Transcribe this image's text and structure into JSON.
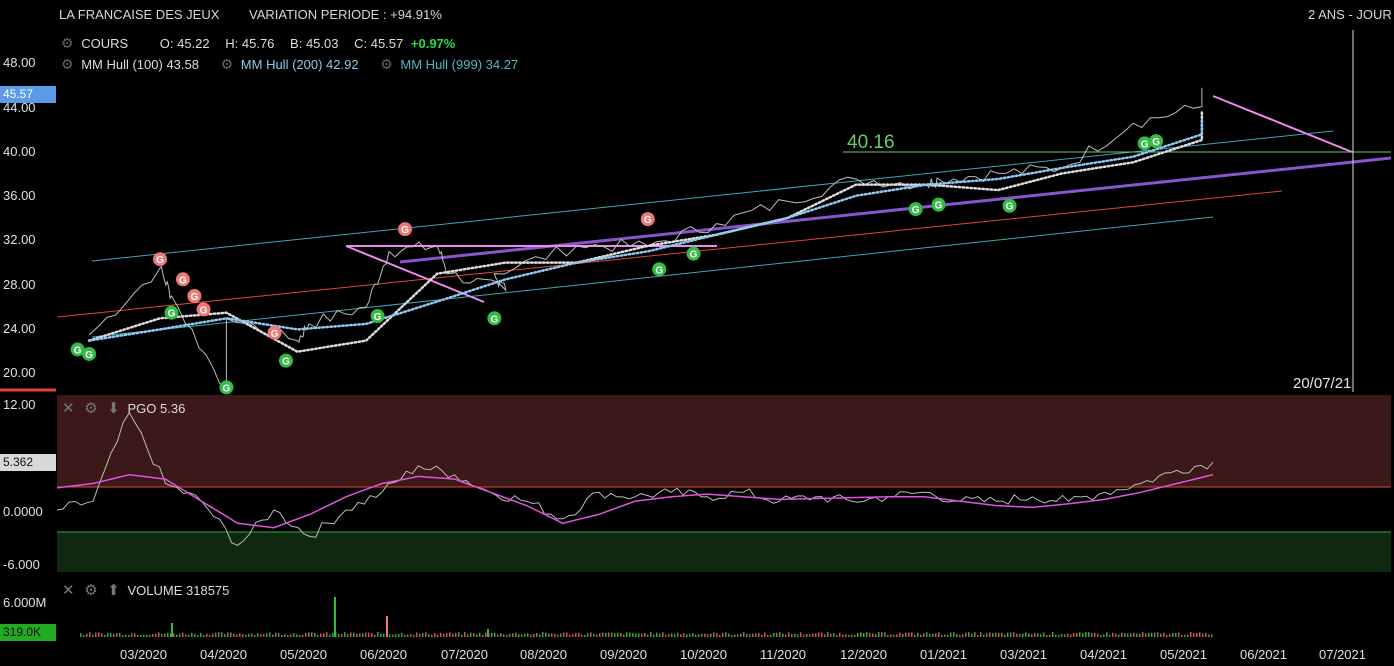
{
  "header": {
    "instrument": "LA FRANCAISE DES JEUX",
    "variation": "VARIATION PERIODE : +94.91%",
    "period": "2 ANS - JOUR"
  },
  "legend": {
    "cours_label": "COURS",
    "o": "O: 45.22",
    "h": "H: 45.76",
    "b": "B: 45.03",
    "c": "C: 45.57",
    "change": "+0.97%",
    "hull100": "MM Hull (100)",
    "hull100_val": "43.58",
    "hull200": "MM Hull (200)",
    "hull200_val": "42.92",
    "hull999": "MM Hull (999)",
    "hull999_val": "34.27"
  },
  "price_box": "45.57",
  "annotation_level": "40.16",
  "date_marker": "20/07/21",
  "pgo": {
    "label": "PGO",
    "value": "5.36",
    "box": "5.362",
    "ticks": [
      "12.00",
      "0.0000",
      "-6.000"
    ]
  },
  "volume": {
    "label": "VOLUME",
    "value": "318575",
    "box": "319.0K",
    "tick": "6.000M"
  },
  "colors": {
    "price": "#bbbbbb",
    "hull100": "#dddddd",
    "hull200": "#8fc8f0",
    "hull999": "#4db8c0",
    "channel": "#39a9b5",
    "support": "#e0453a",
    "trend": "#8855cc",
    "drawing": "#ee88ee",
    "level": "#66cc66",
    "buy_signal": "#33bb44",
    "sell_signal": "#ee7777",
    "pgo_line": "#dd55dd",
    "pgo_upper_zone": "#3c1818",
    "pgo_lower_zone": "#102810",
    "price_box_bg": "#5a9ae6",
    "volume_box_bg": "#22aa22"
  },
  "chart_data": [
    {
      "type": "line",
      "panel": "price",
      "y_ticks": [
        "48.00",
        "44.00",
        "40.00",
        "36.00",
        "32.00",
        "28.00",
        "24.00",
        "20.00"
      ],
      "ylim": [
        18,
        50
      ],
      "x_ticks": [
        "03/2020",
        "04/2020",
        "05/2020",
        "06/2020",
        "07/2020",
        "08/2020",
        "09/2020",
        "10/2020",
        "11/2020",
        "12/2020",
        "01/2021",
        "03/2021",
        "04/2021",
        "05/2021",
        "06/2021",
        "07/2021"
      ],
      "series": [
        {
          "name": "COURS",
          "x": [
            "2020-01",
            "2020-02",
            "2020-02-20",
            "2020-03",
            "2020-03-15",
            "2020-04",
            "2020-04-20",
            "2020-05",
            "2020-05-25",
            "2020-06",
            "2020-06-20",
            "2020-07",
            "2020-07-10",
            "2020-08",
            "2020-09",
            "2020-10",
            "2020-11",
            "2020-12",
            "2021-01",
            "2021-01-20",
            "2021-02",
            "2021-03",
            "2021-04",
            "2021-05",
            "2021-05-15"
          ],
          "values": [
            23.5,
            29.5,
            27,
            18.5,
            25,
            23,
            24.5,
            26,
            31,
            31.5,
            29,
            27.5,
            29,
            31.5,
            31.5,
            33.5,
            35.5,
            37.5,
            37,
            37.5,
            38,
            38.5,
            42.5,
            44,
            45.6
          ]
        },
        {
          "name": "MM Hull (100)",
          "x": [
            "2020-01",
            "2020-02",
            "2020-03",
            "2020-04",
            "2020-05",
            "2020-06",
            "2020-07",
            "2020-08",
            "2020-09",
            "2020-10",
            "2020-11",
            "2020-12",
            "2021-01",
            "2021-02",
            "2021-03",
            "2021-04",
            "2021-05",
            "2021-05-15"
          ],
          "values": [
            23,
            25,
            25.5,
            22,
            23,
            29,
            30,
            30,
            31.5,
            32.5,
            34,
            37,
            37,
            36.5,
            38,
            39,
            41,
            43.6
          ]
        },
        {
          "name": "MM Hull (200)",
          "x": [
            "2020-01",
            "2020-02",
            "2020-03",
            "2020-04",
            "2020-05",
            "2020-06",
            "2020-07",
            "2020-08",
            "2020-09",
            "2020-10",
            "2020-11",
            "2020-12",
            "2021-01",
            "2021-02",
            "2021-03",
            "2021-04",
            "2021-05",
            "2021-05-15"
          ],
          "values": [
            23,
            24,
            25,
            24,
            24.5,
            26.5,
            28.5,
            30,
            31,
            32.5,
            34,
            36,
            37,
            37.5,
            38.5,
            39.5,
            41.5,
            42.9
          ]
        }
      ],
      "signals_buy": [
        [
          "2020-01",
          21.8
        ],
        [
          "2020-01-10",
          22.2
        ],
        [
          "2020-02-20",
          25.5
        ],
        [
          "2020-03-15",
          18.8
        ],
        [
          "2020-04-10",
          21.2
        ],
        [
          "2020-05-20",
          25.2
        ],
        [
          "2020-07-10",
          25
        ],
        [
          "2020-09-20",
          29.4
        ],
        [
          "2020-10-05",
          30.8
        ],
        [
          "2021-01-10",
          34.8
        ],
        [
          "2021-01-20",
          35.2
        ],
        [
          "2021-02-20",
          35.1
        ],
        [
          "2021-04-20",
          40.7
        ],
        [
          "2021-04-25",
          40.9
        ]
      ],
      "signals_sell": [
        [
          "2020-02",
          30.3
        ],
        [
          "2020-02-25",
          28.5
        ],
        [
          "2020-03-01",
          27
        ],
        [
          "2020-03-05",
          25.8
        ],
        [
          "2020-04-05",
          23.7
        ],
        [
          "2020-06-01",
          33
        ],
        [
          "2020-09-15",
          33.9
        ]
      ],
      "level": 40.16
    },
    {
      "type": "line",
      "panel": "PGO",
      "ylim": [
        -7,
        14
      ],
      "series": [
        {
          "name": "PGO",
          "values": [
            0,
            1,
            11,
            3,
            1,
            -4,
            0,
            -3,
            0,
            2,
            5,
            4,
            2,
            1,
            -1,
            2,
            1.5,
            2,
            1.5,
            2,
            1,
            1.5,
            1,
            1.5,
            2,
            1,
            1,
            1.5,
            1,
            2,
            3,
            4.5,
            5.4
          ]
        },
        {
          "name": "PGO signal",
          "values": [
            2.5,
            3,
            4,
            3.5,
            1,
            -1.5,
            -2,
            -0.5,
            1.5,
            3,
            3.8,
            3.5,
            2,
            0.5,
            -1.5,
            -0.5,
            1,
            1.5,
            1.8,
            1.5,
            1.2,
            1.3,
            1.4,
            1.5,
            1.5,
            1,
            0.5,
            0.3,
            0.7,
            1.2,
            2,
            3,
            4
          ]
        }
      ]
    },
    {
      "type": "bar",
      "panel": "VOLUME",
      "ylim": [
        0,
        6000000
      ],
      "values_note_last": 318575
    }
  ]
}
